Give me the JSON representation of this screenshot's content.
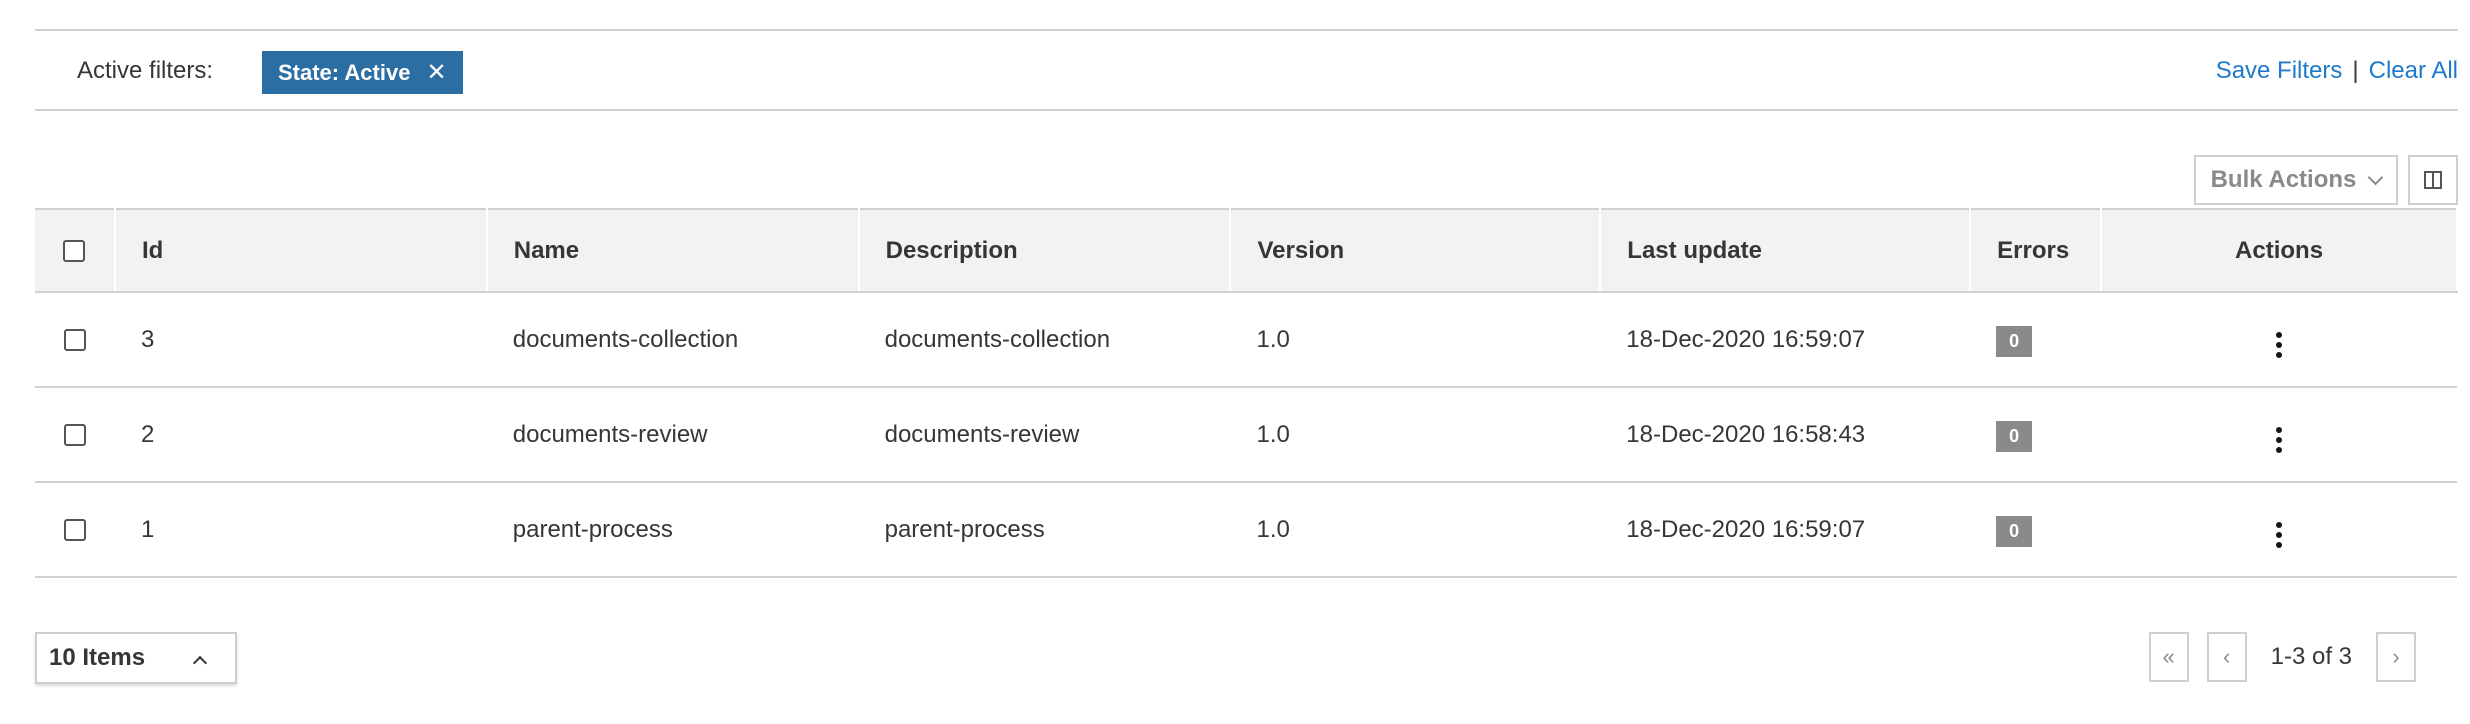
{
  "filters": {
    "label": "Active filters:",
    "chip_label": "State: Active",
    "chip_close": "✕",
    "save_label": "Save Filters",
    "separator": "|",
    "clear_label": "Clear All"
  },
  "toolbar": {
    "bulk_actions_label": "Bulk Actions"
  },
  "table": {
    "columns": [
      "Id",
      "Name",
      "Description",
      "Version",
      "Last update",
      "Errors",
      "Actions"
    ],
    "rows": [
      {
        "id": "3",
        "name": "documents-collection",
        "description": "documents-collection",
        "version": "1.0",
        "last_update": "18-Dec-2020 16:59:07",
        "errors": "0"
      },
      {
        "id": "2",
        "name": "documents-review",
        "description": "documents-review",
        "version": "1.0",
        "last_update": "18-Dec-2020 16:58:43",
        "errors": "0"
      },
      {
        "id": "1",
        "name": "parent-process",
        "description": "parent-process",
        "version": "1.0",
        "last_update": "18-Dec-2020 16:59:07",
        "errors": "0"
      }
    ]
  },
  "pagination": {
    "per_page_label": "10 Items",
    "range_label": "1-3 of 3",
    "first_icon": "«",
    "prev_icon": "‹",
    "next_icon": "›"
  },
  "colors": {
    "chip_bg": "#2b6ea4",
    "link": "#1f7acc",
    "badge_bg": "#8a8a8a",
    "header_bg": "#f2f2f2"
  }
}
